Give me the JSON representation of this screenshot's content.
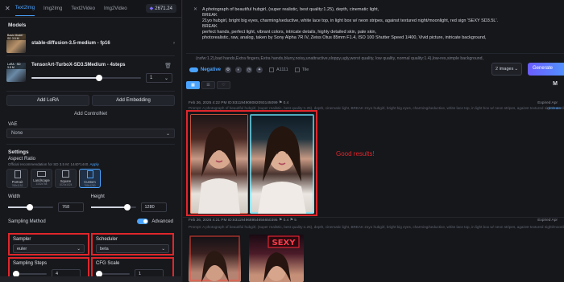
{
  "tabs": [
    "Text2Img",
    "Img2Img",
    "Text2Video",
    "Img2Video"
  ],
  "credits": "2671.24",
  "models_section": {
    "title": "Models",
    "base": {
      "tag": "Basic Model · SD 3.5 M",
      "name": "stable-diffusion-3.5-medium - fp16"
    },
    "lora": {
      "tag": "LoRA · SD 3.5 M",
      "name": "TensorArt-TurboX-SD3.5Medium - 4steps",
      "value": "1",
      "stepper": "⌄"
    },
    "add_lora": "Add LoRA",
    "add_embedding": "Add Embedding",
    "add_controlnet": "Add ControlNet",
    "vae_label": "VAE",
    "vae_value": "None"
  },
  "settings": {
    "title": "Settings",
    "aspect_label": "Aspect Ratio",
    "aspect_hint": "Official recommendation for SD 3.5 M: 1440*1440.",
    "aspect_hint_link": "Apply",
    "aspects": [
      {
        "label": "Portrait",
        "sub": "768x1152"
      },
      {
        "label": "Landscape",
        "sub": "1152x768"
      },
      {
        "label": "Square",
        "sub": "1024x1024"
      },
      {
        "label": "Custom",
        "sub": "768x1280"
      }
    ],
    "width_label": "Width",
    "width_value": "768",
    "height_label": "Height",
    "height_value": "1280",
    "method_label": "Sampling Method",
    "advanced_label": "Advanced",
    "sampler_label": "Sampler",
    "sampler_value": "euler",
    "scheduler_label": "Scheduler",
    "scheduler_value": "beta",
    "steps_label": "Sampling Steps",
    "steps_value": "4",
    "cfg_label": "CFG Scale",
    "cfg_value": "1"
  },
  "prompt": {
    "lines": [
      "A photograph of beautiful hubgirl, (super realistic, best quality:1.25), depth, cinematic light,",
      "BREAK",
      "21yo hubgirl, bright big eyes, charming/seductive, white lace top, in light box w/ neon stripes, against textured night/moonlight, red sign 'SEXY SD3.5L'.",
      "BREAK",
      "perfect hands, perfect light, vibrant colors, intricate details, highly detailed skin, pale skin,",
      "photorealistic, raw, analog,  taken by Sony Alpha 7R IV, Zeiss Otus 85mm F1.4, ISO 100 Shutter Speed 1/400, Vivid picture, intricate background,"
    ],
    "negative": "(nsfw:1.2),bad hands,Extra fingers,Extra hands,blurry,noisy,unattractive,sloppy,ugly,worst quality, low quality, normal quality:1.4),low-res,simple background,"
  },
  "toolbar": {
    "negative_label": "Negative",
    "check1": "A1111",
    "check2": "Tile",
    "images_value": "2 images",
    "generate_label": "Generate"
  },
  "results": {
    "m_label": "M",
    "meta1": "Feb 26, 2025 4:22 PM  ID:831194908082093145099  ⚑ 0.4",
    "meta1_right": "Expired Apr",
    "prompt1": "Prompt: A photograph of beautiful hubgirl, (super realistic, best quality:1.25), depth, cinematic light, BREAK 21yo hubgirl, bright big eyes, charming/seductive, white lace top, in light box w/ neon stripes, against textured night/moonlight,",
    "prompt1_right": "recreate",
    "annotation": "Good results!",
    "meta2": "Feb 26, 2025 4:21 PM  ID:831194968954656650395  ⚑ 0.4  ⚑ 5",
    "meta2_right": "Expired Apr",
    "prompt2": "Prompt: A photograph of beautiful hubgirl, (super realistic, best quality:1.25), depth, cinematic light, BREAK 21yo hubgirl, bright big eyes, charming/seductive, white lace top, in light box w/ neon stripes, against textured night/moonlight,",
    "sign_text": "SEXY"
  },
  "colors": {
    "accent": "#4aa3ff",
    "annotation_red": "#e0262b"
  }
}
